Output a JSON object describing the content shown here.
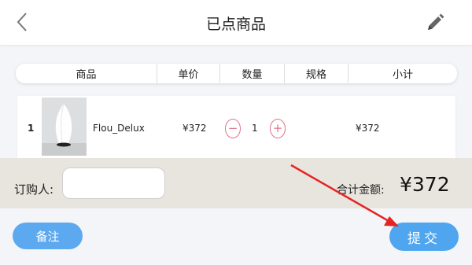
{
  "header": {
    "title": "已点商品",
    "back_icon": "chevron-left-icon",
    "edit_icon": "pencil-icon"
  },
  "table": {
    "columns": [
      "商品",
      "单价",
      "数量",
      "规格",
      "小计"
    ]
  },
  "items": [
    {
      "index": "1",
      "name": "Flou_Delux",
      "price": "¥372",
      "quantity": "1",
      "minus": "−",
      "plus": "+",
      "spec": "",
      "subtotal": "¥372"
    }
  ],
  "order": {
    "buyer_label": "订购人:",
    "buyer_value": "",
    "total_label": "合计金额:",
    "total_value": "¥372"
  },
  "actions": {
    "remark_label": "备注",
    "submit_label": "提交"
  },
  "colors": {
    "accent_blue": "#4fa6ef",
    "stepper_pink": "#e2708a",
    "annotation_red": "#e52424"
  }
}
